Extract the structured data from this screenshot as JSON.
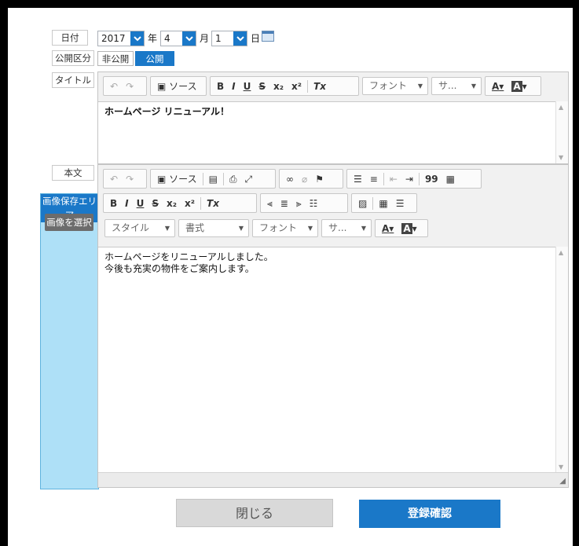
{
  "date": {
    "label": "日付",
    "year_value": "2017",
    "year_unit": "年",
    "month_value": "4",
    "month_unit": "月",
    "day_value": "1",
    "day_unit": "日"
  },
  "visibility": {
    "label": "公開区分",
    "private_label": "非公開",
    "public_label": "公開",
    "selected": "公開"
  },
  "title_field": {
    "label": "タイトル",
    "toolbar": {
      "source": "ソース",
      "bold": "B",
      "italic": "I",
      "underline": "U",
      "strike": "S",
      "subscript": "x₂",
      "superscript": "x²",
      "clear_format": "Tx",
      "font": "フォント",
      "size": "サ...",
      "text_color": "A",
      "bg_color": "A"
    },
    "content": "ホームページ リニューアル！"
  },
  "body_field": {
    "label": "本文",
    "toolbar": {
      "source": "ソース",
      "blockquote": "99",
      "bold": "B",
      "italic": "I",
      "underline": "U",
      "strike": "S",
      "subscript": "x₂",
      "superscript": "x²",
      "clear_format": "Tx",
      "style": "スタイル",
      "format": "書式",
      "font": "フォント",
      "size": "サ...",
      "text_color": "A",
      "bg_color": "A"
    },
    "content_line1": "ホームページをリニューアルしました。",
    "content_line2": "今後も充実の物件をご案内します。"
  },
  "image_area": {
    "title": "画像保存エリア",
    "select_button": "画像を選択"
  },
  "buttons": {
    "close": "閉じる",
    "confirm": "登録確認"
  },
  "colors": {
    "accent": "#1a78c8",
    "sidebar_bg": "#aee0f7",
    "close_bg": "#d9d9d9"
  }
}
